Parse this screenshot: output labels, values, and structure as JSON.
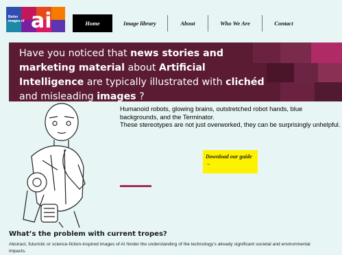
{
  "logo": {
    "line1": "Better",
    "line2": "images of",
    "mark": "ai"
  },
  "nav": {
    "items": [
      {
        "label": "Home",
        "active": true
      },
      {
        "label": "Image library",
        "active": false
      },
      {
        "label": "About",
        "active": false
      },
      {
        "label": "Who We Are",
        "active": false
      },
      {
        "label": "Contact",
        "active": false
      }
    ]
  },
  "hero": {
    "t1": "Have you noticed that ",
    "b1": "news stories and marketing material",
    "t2": " about ",
    "b2": "Artificial Intelligence",
    "t3": " are typically illustrated with ",
    "b3": "clichéd",
    "t4": " and misleading ",
    "b4": "images",
    "t5": " ?"
  },
  "intro": {
    "p1": "Humanoid robots, glowing brains, outstretched robot hands, blue backgrounds, and the Terminator.",
    "p2": "These stereotypes are not just overworked, they can be surprisingly unhelpful."
  },
  "download": {
    "label": "Download our guide →"
  },
  "problem": {
    "title": "What’s the problem with current tropes?",
    "text": "Abstract, futuristic or science-fiction-inspired images of AI hinder the understanding of the technology’s already significant societal and environmental impacts."
  },
  "colors": {
    "background": "#e7f5f4",
    "hero": "#5a1b33",
    "accent": "#a6285a",
    "button": "#fff200"
  }
}
